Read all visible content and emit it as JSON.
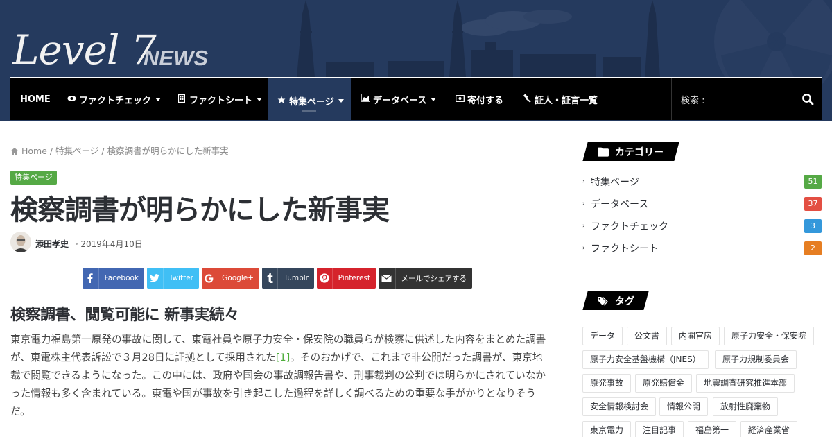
{
  "site": {
    "logo_main": "Level 7",
    "logo_news": "NEWS"
  },
  "nav": {
    "items": [
      {
        "label": "HOME",
        "icon": "",
        "caret": false,
        "active": false
      },
      {
        "label": "ファクトチェック",
        "icon": "eye-icon",
        "caret": true,
        "active": false
      },
      {
        "label": "ファクトシート",
        "icon": "building-icon",
        "caret": true,
        "active": false
      },
      {
        "label": "特集ページ",
        "icon": "star-icon",
        "caret": true,
        "active": true
      },
      {
        "label": "データベース",
        "icon": "area-chart-icon",
        "caret": true,
        "active": false
      },
      {
        "label": "寄付する",
        "icon": "money-icon",
        "caret": false,
        "active": false
      },
      {
        "label": "証人・証言一覧",
        "icon": "gavel-icon",
        "caret": false,
        "active": false
      }
    ],
    "search_label": "検索 :"
  },
  "breadcrumb": {
    "home": "Home",
    "sep": "/",
    "section": "特集ページ",
    "current": "検察調書が明らかにした新事実"
  },
  "post": {
    "category": "特集ページ",
    "title": "検察調書が明らかにした新事実",
    "author": "添田孝史",
    "date": "2019年4月10日",
    "subheading": "検察調書、閲覧可能に 新事実続々",
    "body_before_ref": "東京電力福島第一原発の事故に関して、東電社員や原子力安全・保安院の職員らが検察に供述した内容をまとめた調書が、東電株主代表訴訟で３月28日に証拠として採用された",
    "ref": "[1]",
    "body_after_ref": "。そのおかげで、これまで非公開だった調書が、東京地裁で閲覧できるようになった。この中には、政府や国会の事故調報告書や、刑事裁判の公判では明らかにされていなかった情報も多く含まれている。東電や国が事故を引き起こした過程を詳しく調べるための重要な手がかりとなりそうだ。"
  },
  "share": {
    "facebook": "Facebook",
    "twitter": "Twitter",
    "google": "Google+",
    "tumblr": "Tumblr",
    "pinterest": "Pinterest",
    "email": "メールでシェアする"
  },
  "sidebar": {
    "categories_title": "カテゴリー",
    "categories": [
      {
        "label": "特集ページ",
        "count": "51",
        "color": "#55a945"
      },
      {
        "label": "データベース",
        "count": "37",
        "color": "#e34f43"
      },
      {
        "label": "ファクトチェック",
        "count": "3",
        "color": "#3498db"
      },
      {
        "label": "ファクトシート",
        "count": "2",
        "color": "#e67e22"
      }
    ],
    "tags_title": "タグ",
    "tags": [
      "データ",
      "公文書",
      "内閣官房",
      "原子力安全・保安院",
      "原子力安全基盤機構（JNES）",
      "原子力規制委員会",
      "原発事故",
      "原発賠償金",
      "地震調査研究推進本部",
      "安全情報検討会",
      "情報公開",
      "放射性廃棄物",
      "東京電力",
      "注目記事",
      "福島第一",
      "経済産業省"
    ]
  },
  "colors": {
    "header_bg": "#253a5e",
    "nav_bg": "#000000",
    "accent_green": "#55a945"
  }
}
